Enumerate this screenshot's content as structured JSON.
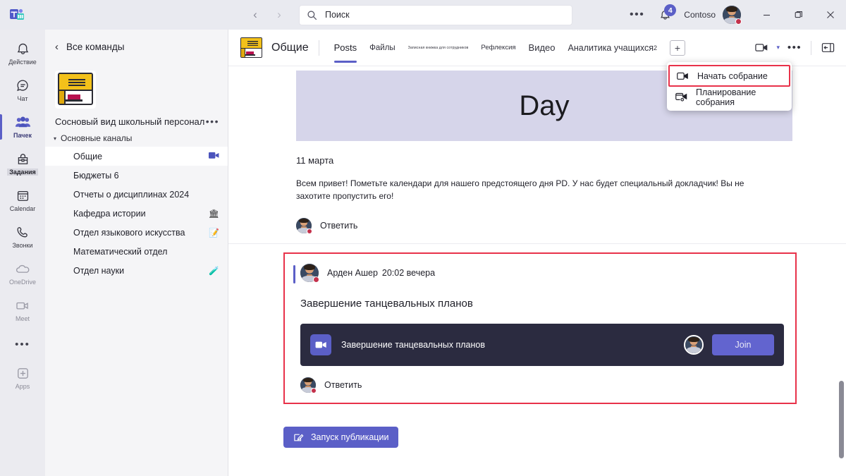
{
  "titlebar": {
    "nav_back": "‹",
    "nav_forward": "›",
    "search_placeholder": "Поиск",
    "search_value": "Поиск",
    "more_label": "•••",
    "notification_count": "4",
    "org": "Contoso",
    "minimize": "—",
    "maximize": "❐",
    "close": "✕"
  },
  "rail": {
    "items": [
      {
        "label": "Действие",
        "icon": "bell-icon"
      },
      {
        "label": "Чат",
        "icon": "chat-icon"
      },
      {
        "label": "Пачек",
        "icon": "teams-icon"
      },
      {
        "label": "Задания",
        "icon": "backpack-icon"
      },
      {
        "label": "Calendar",
        "icon": "calendar-icon"
      },
      {
        "label": "Звонки",
        "icon": "phone-icon"
      },
      {
        "label": "OneDrive",
        "icon": "cloud-icon"
      },
      {
        "label": "Meet",
        "icon": "video-icon"
      }
    ],
    "overflow": "•••",
    "apps_label": "Apps"
  },
  "sidebar": {
    "back_label": "Все команды",
    "team_icon": "book-graduation-icon",
    "team_name": "Сосновый вид школьный персонал",
    "team_more": "•••",
    "group_caret": "▾",
    "group_label": "Основные каналы",
    "channels": [
      {
        "name": "Общие",
        "active": true,
        "trailing_icon": "video-icon",
        "emoji": ""
      },
      {
        "name": "Бюджеты 6",
        "active": false,
        "trailing_icon": "",
        "emoji": ""
      },
      {
        "name": "Отчеты о дисциплинах 2024",
        "active": false,
        "trailing_icon": "",
        "emoji": ""
      },
      {
        "name": "Кафедра истории",
        "active": false,
        "trailing_icon": "",
        "emoji": "🏛"
      },
      {
        "name": "Отдел языкового искусства",
        "active": false,
        "trailing_icon": "",
        "emoji": "📝"
      },
      {
        "name": "Математический отдел",
        "active": false,
        "trailing_icon": "",
        "emoji": ""
      },
      {
        "name": "Отдел науки",
        "active": false,
        "trailing_icon": "",
        "emoji": "🧪"
      }
    ]
  },
  "channel_header": {
    "icon": "book-graduation-icon",
    "title": "Общие",
    "tabs": [
      {
        "label": "Posts",
        "active": true
      },
      {
        "label": "Файлы",
        "active": false
      },
      {
        "label": "Записная книжка для сотрудников",
        "active": false
      },
      {
        "label": "Рефлексия",
        "active": false
      },
      {
        "label": "Видео",
        "active": false
      },
      {
        "label": "Аналитика учащихся",
        "active": false,
        "superscript": "2"
      }
    ],
    "add_tab": "+",
    "meet_icon": "video-camera-icon",
    "meet_caret": "▾",
    "more": "•••",
    "panel_icon": "open-panel-icon"
  },
  "flyout": {
    "items": [
      {
        "label": "Начать собрание",
        "icon": "video-camera-icon",
        "highlighted": true
      },
      {
        "label": "Планирование собрания",
        "icon": "schedule-meeting-icon",
        "highlighted": false
      }
    ]
  },
  "posts": [
    {
      "banner_text": "Day",
      "date": "11 марта",
      "body": "Всем привет! Пометьте календари для нашего предстоящего дня PD. У нас будет специальный докладчик! Вы не захотите пропустить его!",
      "reply_label": "Ответить"
    }
  ],
  "highlighted_post": {
    "author": "Арден Ашер",
    "time": "20:02 вечера",
    "subject": "Завершение танцевальных планов",
    "meeting_card": {
      "icon": "video-camera-icon",
      "title": "Завершение танцевальных планов",
      "join_label": "Join",
      "avatar": "arden-asher-avatar"
    },
    "reply_label": "Ответить"
  },
  "new_post_button": {
    "label": "Запуск публикации",
    "icon": "compose-icon"
  },
  "colors": {
    "accent": "#5b5fc7",
    "highlight_border": "#e8324a",
    "banner": "#d6d5ea",
    "meeting_card": "#2b2b40",
    "join_button": "#6264cf",
    "titlebar": "#e9eaf0",
    "rail": "#ebebf0",
    "sidebar": "#f5f5f7",
    "presence_busy": "#c4314b"
  }
}
